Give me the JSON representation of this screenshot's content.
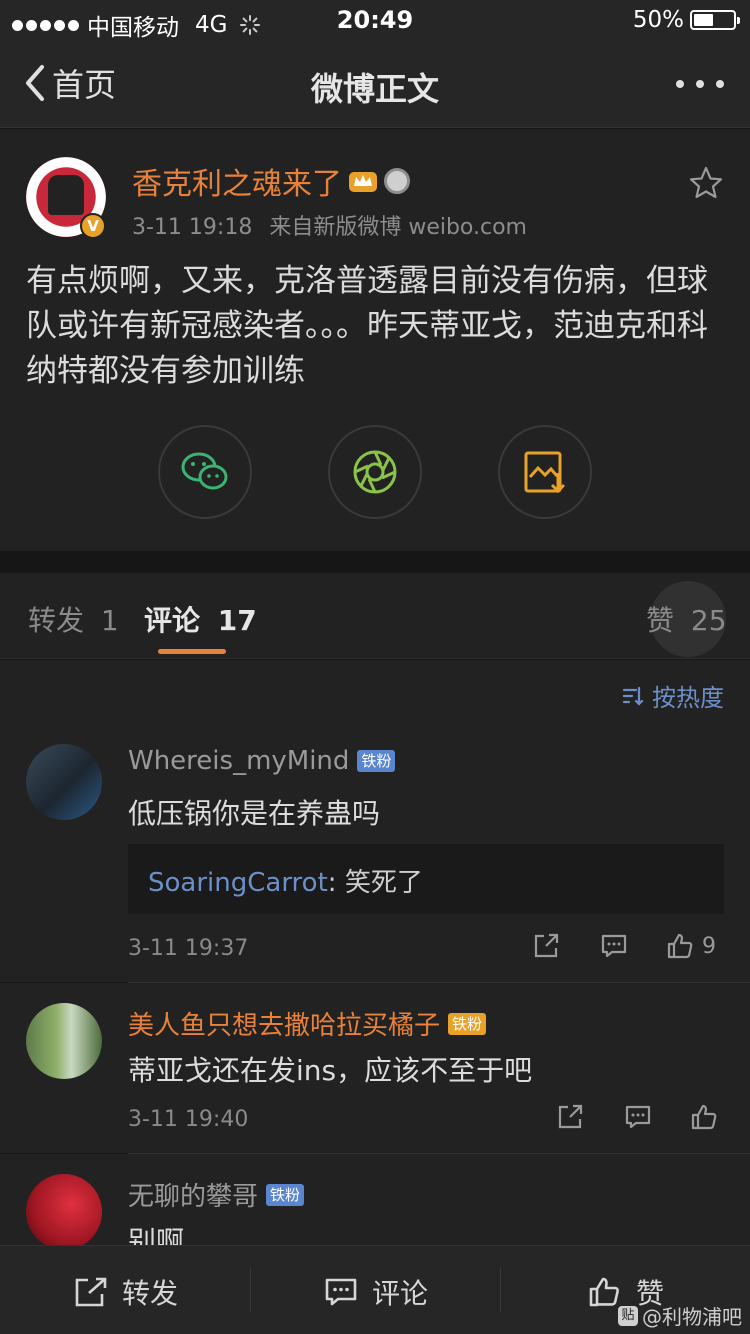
{
  "status_bar": {
    "carrier": "中国移动",
    "network": "4G",
    "time": "20:49",
    "battery": "50%",
    "battery_level": 0.5
  },
  "nav": {
    "back_label": "首页",
    "title": "微博正文"
  },
  "post": {
    "author": "香克利之魂来了",
    "time": "3-11 19:18",
    "source": "来自新版微博 weibo.com",
    "text": "有点烦啊，又来，克洛普透露目前没有伤病，但球队或许有新冠感染者。。。昨天蒂亚戈，范迪克和科纳特都没有参加训练",
    "share_icons": [
      "wechat-icon",
      "moments-icon",
      "save-image-icon"
    ]
  },
  "tabs": {
    "repost_label": "转发",
    "repost_count": "1",
    "comment_label": "评论",
    "comment_count": "17",
    "like_label": "赞",
    "like_count": "25"
  },
  "sort": {
    "label": "按热度"
  },
  "comments": [
    {
      "user": "Whereis_myMind",
      "badge": "铁粉",
      "text": "低压锅你是在养蛊吗",
      "reply_user": "SoaringCarrot",
      "reply_text": "笑死了",
      "time": "3-11 19:37",
      "likes": "9"
    },
    {
      "user": "美人鱼只想去撒哈拉买橘子",
      "badge": "铁粉",
      "text": "蒂亚戈还在发ins，应该不至于吧",
      "time": "3-11 19:40"
    },
    {
      "user": "无聊的攀哥",
      "badge": "铁粉",
      "text": "别啊"
    }
  ],
  "bottom_bar": {
    "repost": "转发",
    "comment": "评论",
    "like": "赞"
  },
  "watermark": "@利物浦吧",
  "colors": {
    "accent": "#e8813a",
    "link": "#6d8fc9",
    "background": "#161616",
    "card": "#222222"
  }
}
